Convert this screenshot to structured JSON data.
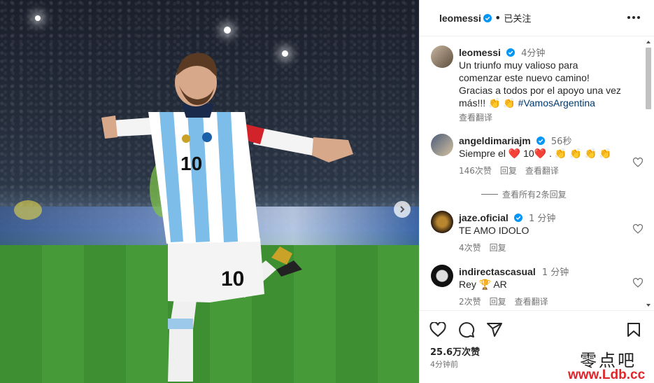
{
  "post": {
    "author": "leomessi",
    "follow_status": "已关注",
    "more_icon": "more-horizontal-icon",
    "caption_time": "4分钟",
    "caption_lines": [
      "Un triunfo muy valioso para",
      "comenzar este nuevo camino!",
      "Gracias a todos por el apoyo una vez",
      "más!!! 👏 👏 "
    ],
    "caption_hashtag": "#VamosArgentina",
    "see_translation": "查看翻译",
    "likes": "25.6万次赞",
    "posted": "4分钟前"
  },
  "comments": [
    {
      "user": "angeldimariajm",
      "verified": true,
      "time": "56秒",
      "text": "Siempre el ❤️ 10❤️ . 👏 👏 👏 👏",
      "likes": "146次赞",
      "reply": "回复",
      "translate": "查看翻译",
      "view_replies": "查看所有2条回复"
    },
    {
      "user": "jaze.oficial",
      "verified": true,
      "time": "1 分钟",
      "text": "TE AMO IDOLO",
      "likes": "4次赞",
      "reply": "回复"
    },
    {
      "user": "indirectascasual",
      "verified": false,
      "time": "1 分钟",
      "text": "Rey 🏆 AR",
      "likes": "2次赞",
      "reply": "回复",
      "translate": "查看翻译"
    }
  ],
  "watermark": {
    "line1": "零点吧",
    "line2": "www.Ldb.cc"
  },
  "colors": {
    "accent": "#0095f6",
    "heart_red": "#ed4956",
    "text": "#262626",
    "muted": "#737373"
  }
}
